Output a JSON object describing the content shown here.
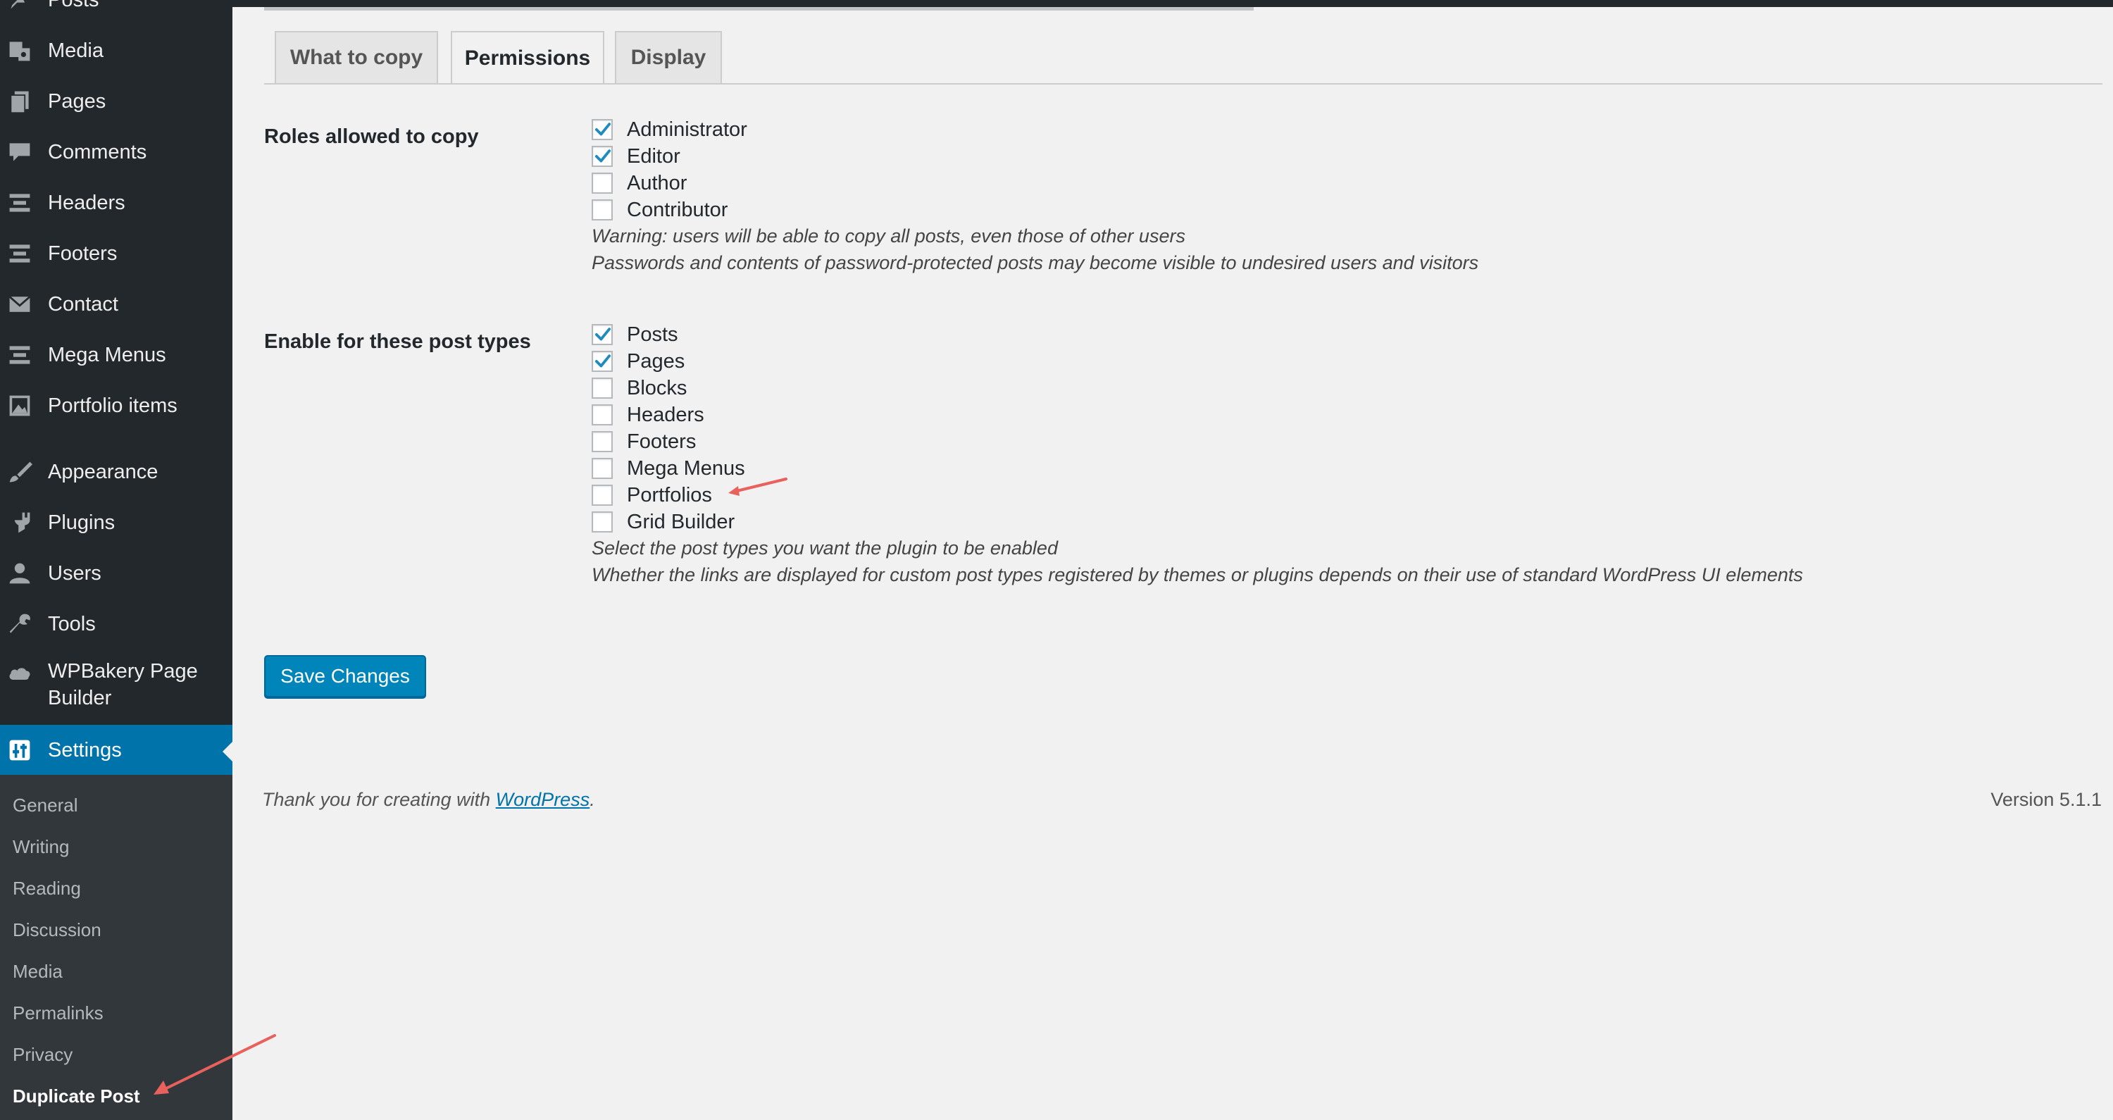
{
  "sidebar": {
    "top_partial_label": "Posts",
    "items": [
      {
        "label": "Media",
        "icon": "media-icon"
      },
      {
        "label": "Pages",
        "icon": "pages-icon"
      },
      {
        "label": "Comments",
        "icon": "comments-icon"
      },
      {
        "label": "Headers",
        "icon": "list-icon"
      },
      {
        "label": "Footers",
        "icon": "list-icon"
      },
      {
        "label": "Contact",
        "icon": "mail-icon"
      },
      {
        "label": "Mega Menus",
        "icon": "list-icon"
      },
      {
        "label": "Portfolio items",
        "icon": "image-icon"
      },
      {
        "label": "Appearance",
        "icon": "brush-icon"
      },
      {
        "label": "Plugins",
        "icon": "plugin-icon"
      },
      {
        "label": "Users",
        "icon": "user-icon"
      },
      {
        "label": "Tools",
        "icon": "wrench-icon"
      },
      {
        "label": "WPBakery Page Builder",
        "icon": "cloud-icon"
      }
    ],
    "active": {
      "label": "Settings",
      "icon": "settings-icon"
    },
    "submenu": [
      "General",
      "Writing",
      "Reading",
      "Discussion",
      "Media",
      "Permalinks",
      "Privacy",
      "Duplicate Post"
    ],
    "current_submenu": "Duplicate Post"
  },
  "tabs": [
    {
      "label": "What to copy",
      "active": false
    },
    {
      "label": "Permissions",
      "active": true
    },
    {
      "label": "Display",
      "active": false
    }
  ],
  "roles": {
    "label": "Roles allowed to copy",
    "options": [
      {
        "label": "Administrator",
        "checked": true
      },
      {
        "label": "Editor",
        "checked": true
      },
      {
        "label": "Author",
        "checked": false
      },
      {
        "label": "Contributor",
        "checked": false
      }
    ],
    "notes": [
      "Warning: users will be able to copy all posts, even those of other users",
      "Passwords and contents of password-protected posts may become visible to undesired users and visitors"
    ]
  },
  "post_types": {
    "label": "Enable for these post types",
    "options": [
      {
        "label": "Posts",
        "checked": true
      },
      {
        "label": "Pages",
        "checked": true
      },
      {
        "label": "Blocks",
        "checked": false
      },
      {
        "label": "Headers",
        "checked": false
      },
      {
        "label": "Footers",
        "checked": false
      },
      {
        "label": "Mega Menus",
        "checked": false
      },
      {
        "label": "Portfolios",
        "checked": false
      },
      {
        "label": "Grid Builder",
        "checked": false
      }
    ],
    "notes": [
      "Select the post types you want the plugin to be enabled",
      "Whether the links are displayed for custom post types registered by themes or plugins depends on their use of standard WordPress UI elements"
    ]
  },
  "save_label": "Save Changes",
  "footer": {
    "prefix": "Thank you for creating with ",
    "link": "WordPress",
    "suffix": ".",
    "version": "Version 5.1.1"
  },
  "colors": {
    "sidebar_bg": "#23282d",
    "submenu_bg": "#32373c",
    "accent": "#0073aa",
    "button": "#0085ba",
    "annotation_arrow": "#e8615c"
  }
}
